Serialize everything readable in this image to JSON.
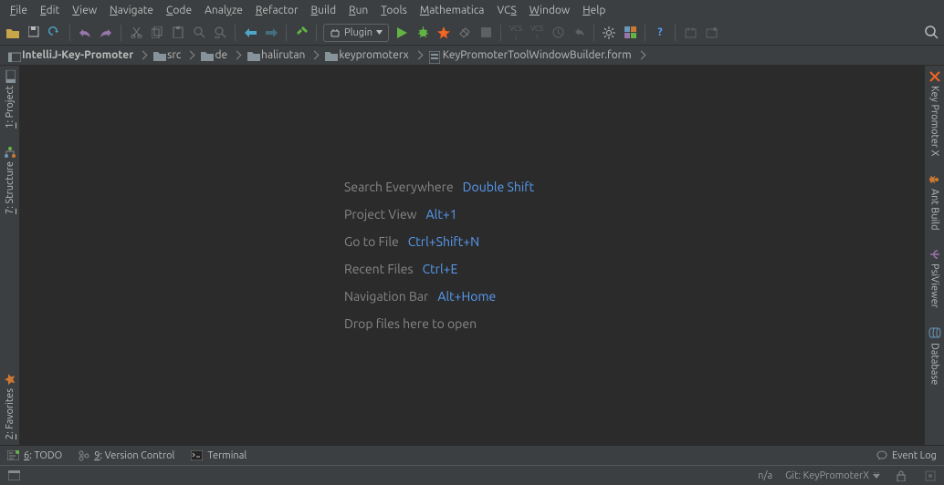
{
  "menu": [
    "File",
    "Edit",
    "View",
    "Navigate",
    "Code",
    "Analyze",
    "Refactor",
    "Build",
    "Run",
    "Tools",
    "Mathematica",
    "VCS",
    "Window",
    "Help"
  ],
  "menuMnemonic": [
    0,
    0,
    0,
    0,
    0,
    4,
    0,
    0,
    0,
    0,
    0,
    2,
    0,
    0
  ],
  "runConfig": {
    "label": "Plugin"
  },
  "breadcrumbs": [
    {
      "label": "IntelliJ-Key-Promoter",
      "icon": "project",
      "bold": true
    },
    {
      "label": "src",
      "icon": "folder",
      "bold": false
    },
    {
      "label": "de",
      "icon": "folder",
      "bold": false
    },
    {
      "label": "halirutan",
      "icon": "folder",
      "bold": false
    },
    {
      "label": "keypromoterx",
      "icon": "folder",
      "bold": false
    },
    {
      "label": "KeyPromoterToolWindowBuilder.form",
      "icon": "form",
      "bold": false
    }
  ],
  "leftTabs": [
    {
      "label": "1: Project",
      "icon": "project"
    },
    {
      "label": "7: Structure",
      "icon": "structure"
    },
    {
      "label": "2: Favorites",
      "icon": "favorites"
    }
  ],
  "rightTabs": [
    {
      "label": "Key Promoter X",
      "icon": "kpx"
    },
    {
      "label": "Ant Build",
      "icon": "ant"
    },
    {
      "label": "PsiViewer",
      "icon": "psi"
    },
    {
      "label": "Database",
      "icon": "db"
    }
  ],
  "hints": [
    {
      "label": "Search Everywhere",
      "shortcut": "Double Shift"
    },
    {
      "label": "Project View",
      "shortcut": "Alt+1"
    },
    {
      "label": "Go to File",
      "shortcut": "Ctrl+Shift+N"
    },
    {
      "label": "Recent Files",
      "shortcut": "Ctrl+E"
    },
    {
      "label": "Navigation Bar",
      "shortcut": "Alt+Home"
    }
  ],
  "dropText": "Drop files here to open",
  "bottomTabs": [
    {
      "label": "6: TODO",
      "icon": "todo"
    },
    {
      "label": "9: Version Control",
      "icon": "vcs"
    },
    {
      "label": "Terminal",
      "icon": "terminal"
    }
  ],
  "eventLog": "Event Log",
  "status": {
    "encoding": "n/a",
    "git": "Git: KeyPromoterX"
  }
}
